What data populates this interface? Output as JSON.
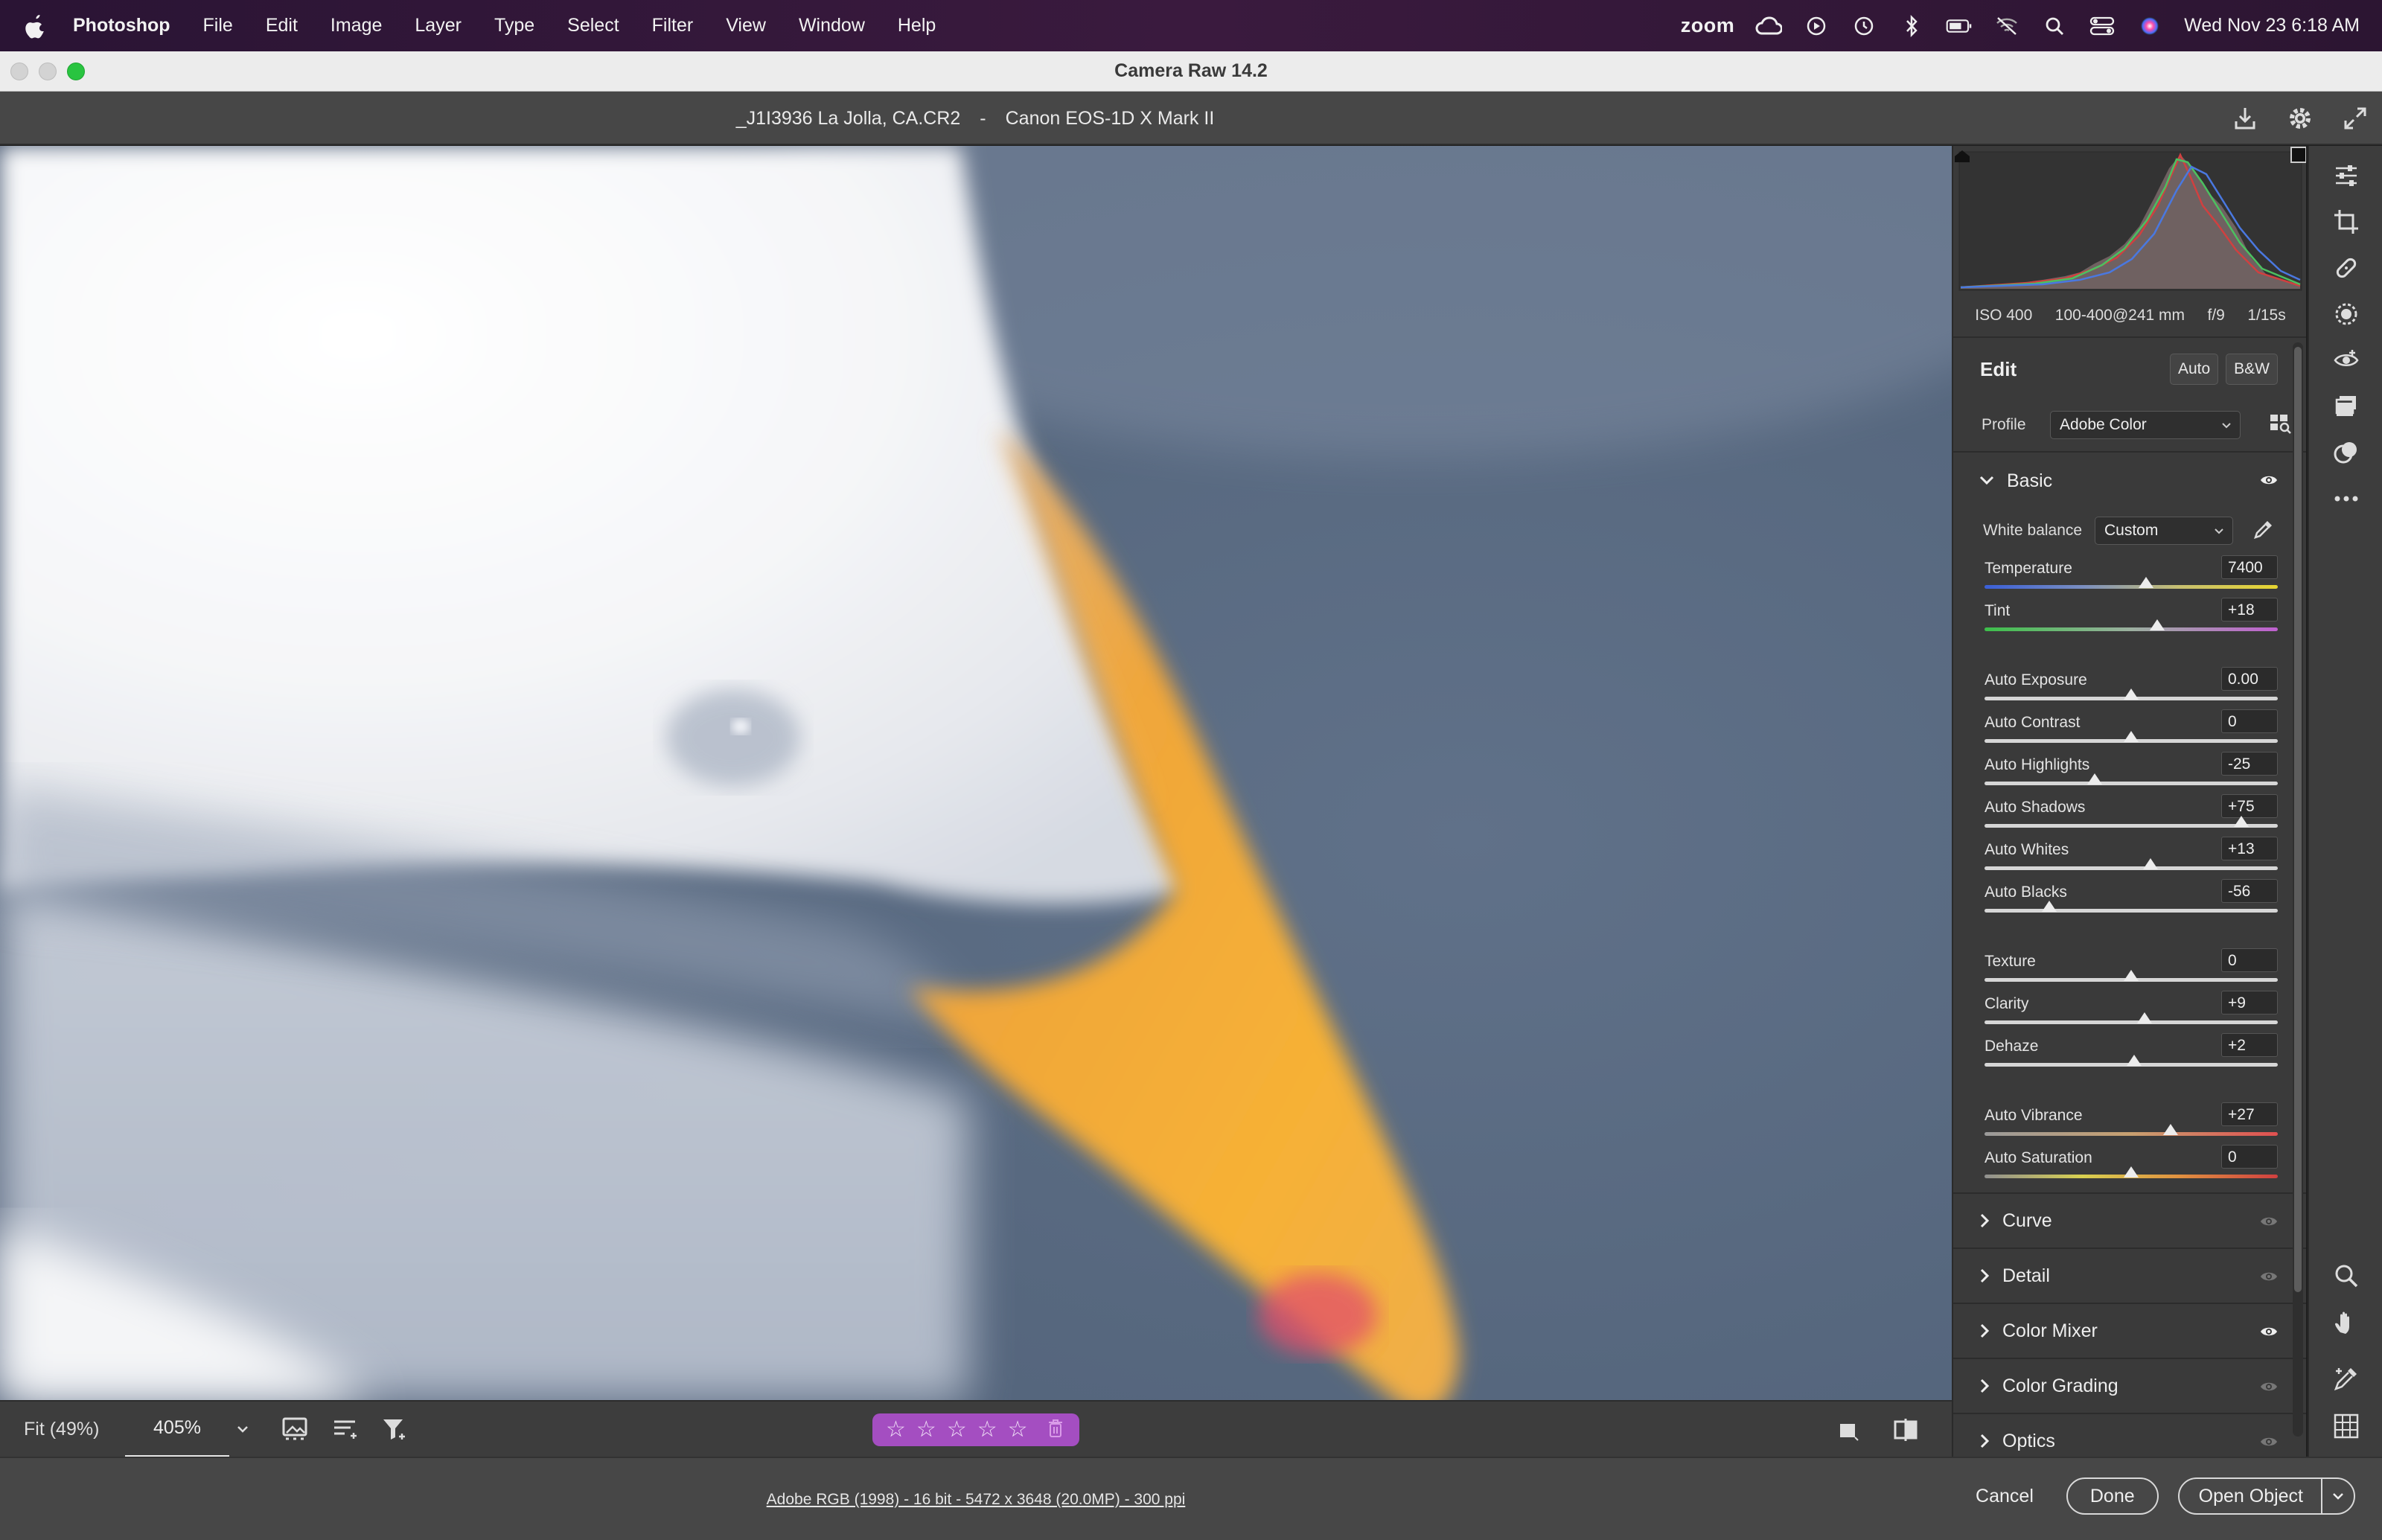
{
  "menubar": {
    "app": "Photoshop",
    "items": [
      "File",
      "Edit",
      "Image",
      "Layer",
      "Type",
      "Select",
      "Filter",
      "View",
      "Window",
      "Help"
    ],
    "zoom": "zoom",
    "clock": "Wed Nov 23  6:18 AM",
    "icons": [
      "apple-icon",
      "creative-cloud-icon",
      "play-icon",
      "time-machine-icon",
      "bluetooth-icon",
      "battery-icon",
      "wifi-off-icon",
      "search-icon",
      "control-center-icon",
      "siri-icon"
    ]
  },
  "window": {
    "title": "Camera Raw 14.2"
  },
  "header": {
    "filename": "_J1I3936  La Jolla, CA.CR2",
    "separator": "-",
    "camera": "Canon EOS-1D X Mark II"
  },
  "histogram": {
    "exif": [
      "ISO 400",
      "100-400@241 mm",
      "f/9",
      "1/15s"
    ]
  },
  "edit": {
    "title": "Edit",
    "auto_label": "Auto",
    "bw_label": "B&W",
    "profile_label": "Profile",
    "profile_value": "Adobe Color"
  },
  "basic": {
    "title": "Basic",
    "wb_label": "White balance",
    "wb_value": "Custom",
    "groups": [
      [
        {
          "label": "Temperature",
          "value": "7400",
          "pos": 0.55,
          "track": "temp"
        },
        {
          "label": "Tint",
          "value": "+18",
          "pos": 0.59,
          "track": "tint"
        }
      ],
      [
        {
          "label": "Auto Exposure",
          "value": "0.00",
          "pos": 0.5,
          "track": "plain"
        },
        {
          "label": "Auto Contrast",
          "value": "0",
          "pos": 0.5,
          "track": "plain"
        },
        {
          "label": "Auto Highlights",
          "value": "-25",
          "pos": 0.375,
          "track": "plain"
        },
        {
          "label": "Auto Shadows",
          "value": "+75",
          "pos": 0.875,
          "track": "plain"
        },
        {
          "label": "Auto Whites",
          "value": "+13",
          "pos": 0.565,
          "track": "plain"
        },
        {
          "label": "Auto Blacks",
          "value": "-56",
          "pos": 0.22,
          "track": "plain"
        }
      ],
      [
        {
          "label": "Texture",
          "value": "0",
          "pos": 0.5,
          "track": "plain"
        },
        {
          "label": "Clarity",
          "value": "+9",
          "pos": 0.545,
          "track": "plain"
        },
        {
          "label": "Dehaze",
          "value": "+2",
          "pos": 0.51,
          "track": "plain"
        }
      ],
      [
        {
          "label": "Auto Vibrance",
          "value": "+27",
          "pos": 0.635,
          "track": "vib"
        },
        {
          "label": "Auto Saturation",
          "value": "0",
          "pos": 0.5,
          "track": "sat"
        }
      ]
    ]
  },
  "sections": [
    {
      "name": "Curve",
      "eye": "dim"
    },
    {
      "name": "Detail",
      "eye": "dim"
    },
    {
      "name": "Color Mixer",
      "eye": "bright"
    },
    {
      "name": "Color Grading",
      "eye": "dim"
    },
    {
      "name": "Optics",
      "eye": "dim"
    }
  ],
  "toolbar": {
    "fit": "Fit (49%)",
    "zoom": "405%",
    "stars": [
      "☆",
      "☆",
      "☆",
      "☆",
      "☆"
    ]
  },
  "footer": {
    "workflow": "Adobe RGB (1998) - 16 bit - 5472 x 3648 (20.0MP) - 300 ppi",
    "cancel": "Cancel",
    "done": "Done",
    "open": "Open Object"
  },
  "colors": {
    "accent_rating": "#a44ec1",
    "panel_bg": "#3a3a3a",
    "photo_sky": "#55667f",
    "beak": "#f0a838"
  }
}
